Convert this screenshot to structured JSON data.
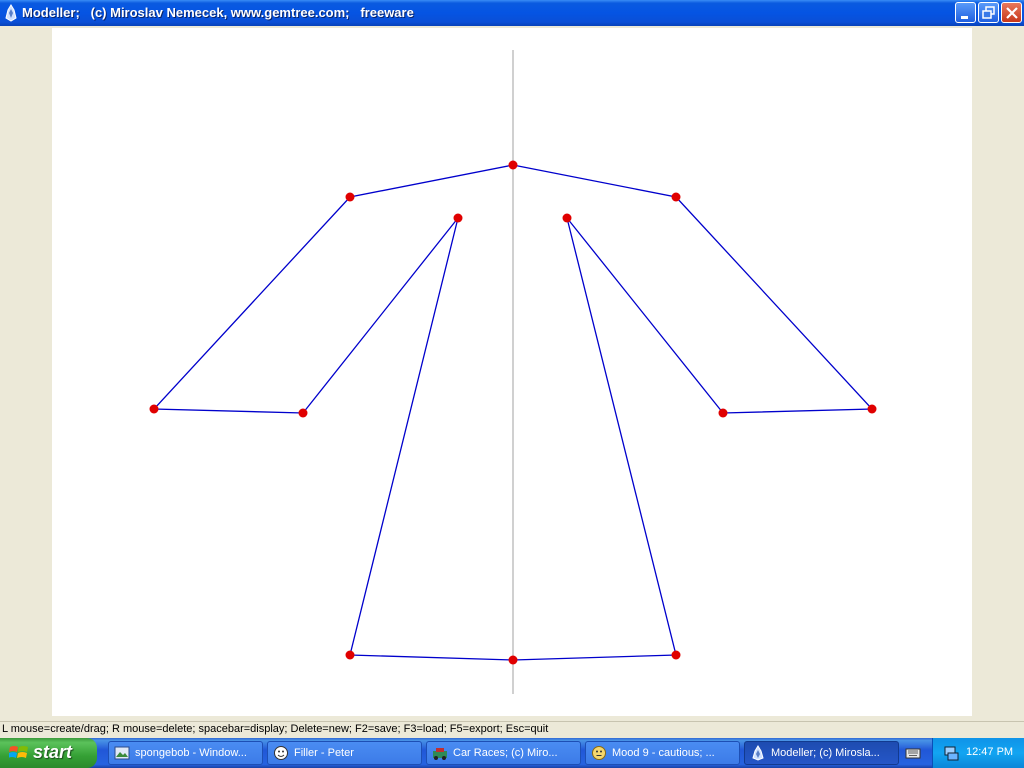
{
  "window": {
    "title": "Modeller;   (c) Miroslav Nemecek, www.gemtree.com;   freeware"
  },
  "status_bar": {
    "text": "L mouse=create/drag; R mouse=delete; spacebar=display; Delete=new; F2=save; F3=load; F5=export; Esc=quit"
  },
  "taskbar": {
    "start_label": "start",
    "tasks": [
      {
        "label": "spongebob - Window...",
        "icon": "image-viewer-icon",
        "active": false
      },
      {
        "label": "Filler - Peter",
        "icon": "filler-app-icon",
        "active": false
      },
      {
        "label": "Car Races;   (c) Miro...",
        "icon": "car-races-icon",
        "active": false
      },
      {
        "label": "Mood 9 - cautious;  ...",
        "icon": "smiley-icon",
        "active": false
      },
      {
        "label": "Modeller;   (c) Mirosla...",
        "icon": "modeller-icon",
        "active": true
      }
    ],
    "clock": "12:47 PM"
  },
  "colors": {
    "point": "#e00000",
    "line": "#0000cc",
    "axis": "#c0c0c0"
  }
}
